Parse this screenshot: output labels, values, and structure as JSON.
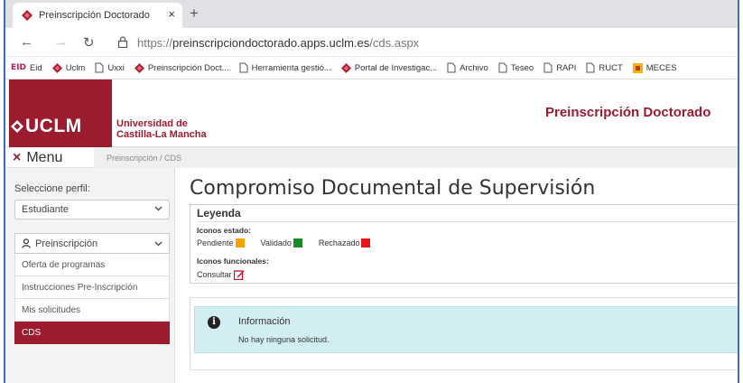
{
  "browser": {
    "tab_title": "Preinscripción Doctorado",
    "tab_close": "×",
    "new_tab": "+",
    "url_scheme": "https://",
    "url_host": "preinscripciondoctorado.apps.uclm.es",
    "url_path": "/cds.aspx"
  },
  "bookmarks": [
    {
      "label": "Eid",
      "icon": "eid-logo"
    },
    {
      "label": "Uclm",
      "icon": "uclm-diamond-icon"
    },
    {
      "label": "Uxxi",
      "icon": "page-icon"
    },
    {
      "label": "Preinscripción Doct...",
      "icon": "uclm-diamond-icon"
    },
    {
      "label": "Herramienta gestió...",
      "icon": "page-icon"
    },
    {
      "label": "Portal de Investigac...",
      "icon": "uclm-diamond-icon"
    },
    {
      "label": "Archivo",
      "icon": "page-icon"
    },
    {
      "label": "Teseo",
      "icon": "page-icon"
    },
    {
      "label": "RAPI",
      "icon": "page-icon"
    },
    {
      "label": "RUCT",
      "icon": "page-icon"
    },
    {
      "label": "MECES",
      "icon": "meces-icon"
    }
  ],
  "eid_logo_text": "EID",
  "header": {
    "logo_text": "UCLM",
    "univ_line1": "Universidad de",
    "univ_line2": "Castilla-La Mancha",
    "site_title": "Preinscripción Doctorado"
  },
  "menu": {
    "toggle_icon": "×",
    "toggle_label": "Menu",
    "breadcrumb": "Preinscripción / CDS"
  },
  "sidebar": {
    "profile_label": "Seleccione perfil:",
    "profile_value": "Estudiante",
    "section_label": "Preinscripción",
    "items": [
      {
        "label": "Oferta de programas",
        "active": false
      },
      {
        "label": "Instrucciones Pre-Inscripción",
        "active": false
      },
      {
        "label": "Mis solicitudes",
        "active": false
      },
      {
        "label": "CDS",
        "active": true
      }
    ]
  },
  "main": {
    "title": "Compromiso Documental de Supervisión",
    "legend": {
      "title": "Leyenda",
      "estado_heading": "Iconos estado:",
      "estados": [
        {
          "label": "Pendiente",
          "color": "#f5a300"
        },
        {
          "label": "Validado",
          "color": "#1c8a25"
        },
        {
          "label": "Rechazado",
          "color": "#e8141b"
        }
      ],
      "funcionales_heading": "Iconos funcionales:",
      "consultar_label": "Consultar"
    },
    "info": {
      "icon": "i",
      "title": "Información",
      "text": "No hay ninguna solicitud."
    }
  },
  "colors": {
    "brand": "#9b1b2f",
    "info_bg": "#d3eef3"
  }
}
